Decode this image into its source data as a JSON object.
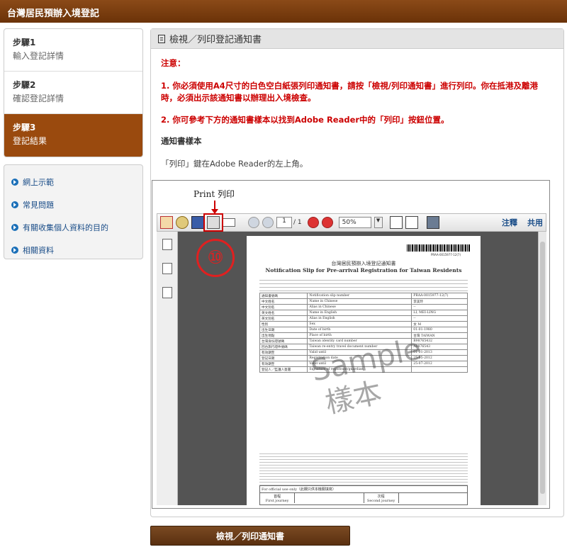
{
  "header": {
    "title": "台灣居民預辦入境登記"
  },
  "steps": [
    {
      "num": "步驟1",
      "label": "輸入登記詳情"
    },
    {
      "num": "步驟2",
      "label": "確認登記詳情"
    },
    {
      "num": "步驟3",
      "label": "登記結果",
      "active": true
    }
  ],
  "links": [
    "網上示範",
    "常見問題",
    "有關收集個人資料的目的",
    "相關資料"
  ],
  "panel": {
    "title": "檢視／列印登記通知書",
    "note_title": "注意：",
    "note1": "1. 你必須使用A4尺寸的白色空白紙張列印通知書，請按「檢視/列印通知書」進行列印。你在抵港及離港時，必須出示該通知書以辦理出入境檢查。",
    "note2": "2. 你可參考下方的通知書樣本以找到Adobe Reader中的「列印」按鈕位置。",
    "sample_title": "通知書樣本",
    "sample_desc": "「列印」鍵在Adobe Reader的左上角。"
  },
  "viewer": {
    "print_label": "Print  列印",
    "page_current": "1",
    "page_total": "/ 1",
    "zoom": "50%",
    "comment": "注釋",
    "share": "共用",
    "annotation": "⑩"
  },
  "slip": {
    "barcode_no": "PRAA-0015977-12(7)",
    "title_zh": "台灣居民預辦入境登記通知書",
    "title_en": "Notification Slip for Pre-arrival Registration for Taiwan Residents",
    "rows": [
      [
        "通知書號碼",
        "Notification slip number",
        "PRAA-0015977-12(7)"
      ],
      [
        "中文姓名",
        "Name in Chinese",
        "李美玲"
      ],
      [
        "中文別名",
        "Alias in Chinese",
        "--"
      ],
      [
        "英文姓名",
        "Name in English",
        "LI, MEI-LING"
      ],
      [
        "英文別名",
        "Alias in English",
        "--"
      ],
      [
        "性別",
        "Sex",
        "女 M"
      ],
      [
        "出生日期",
        "Date of birth",
        "01-01-1980"
      ],
      [
        "出生地點",
        "Place of birth",
        "台灣 TAIWAN"
      ],
      [
        "台灣身份證號碼",
        "Taiwan identity card number",
        "B98765432"
      ],
      [
        "回台旅行證件號碼",
        "Taiwan re-entry travel document number",
        "A9876543"
      ],
      [
        "有效期至",
        "Valid until",
        "01-01-2013"
      ],
      [
        "登記日期",
        "Registration date",
        "25-05-2012"
      ],
      [
        "有效期至",
        "Valid until",
        "25-07-2012"
      ],
      [
        "登記人／監護人簽署",
        "Signature of registrant/guardian",
        ""
      ]
    ],
    "official": "For official use only（此欄只供本機關填寫）",
    "first": [
      "首程",
      "First journey"
    ],
    "second": [
      "次程",
      "Second journey"
    ],
    "watermark_en": "Sample",
    "watermark_zh": "樣本"
  },
  "action": {
    "view_print": "檢視／列印通知書"
  }
}
